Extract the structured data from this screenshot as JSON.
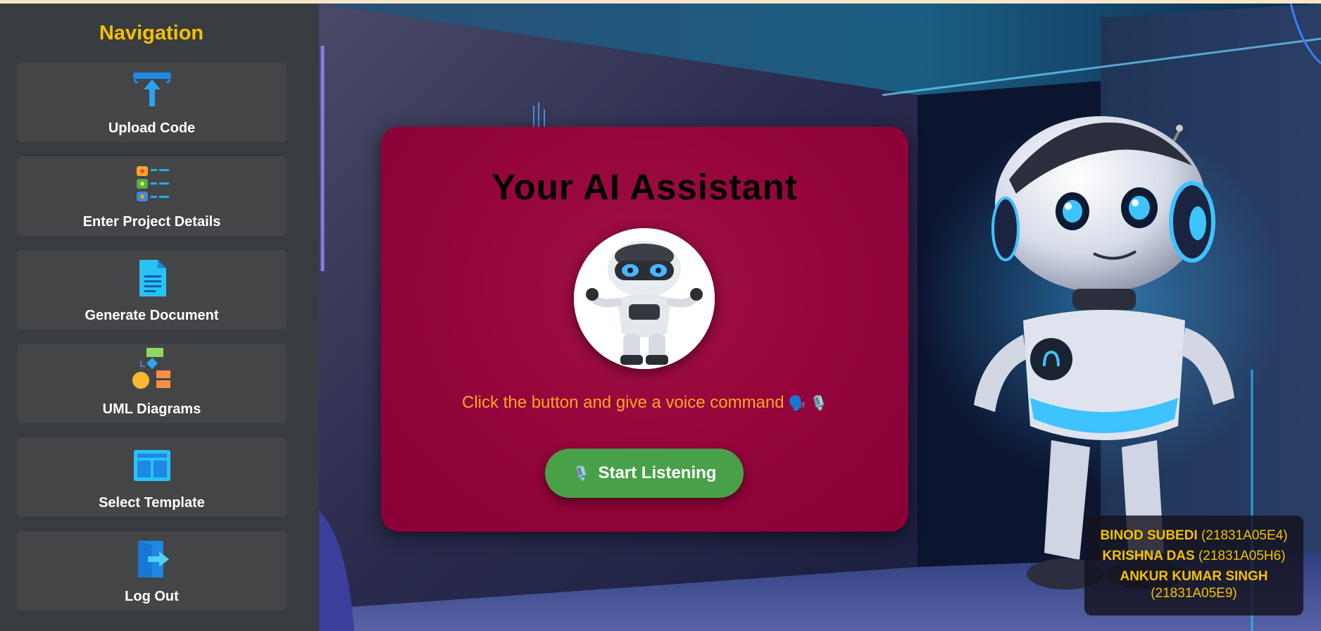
{
  "nav": {
    "title": "Navigation",
    "items": [
      {
        "label": "Upload Code",
        "icon": "upload-icon"
      },
      {
        "label": "Enter Project Details",
        "icon": "checklist-icon"
      },
      {
        "label": "Generate Document",
        "icon": "document-icon"
      },
      {
        "label": "UML Diagrams",
        "icon": "shapes-diagram-icon"
      },
      {
        "label": "Select Template",
        "icon": "template-layout-icon"
      },
      {
        "label": "Log Out",
        "icon": "logout-icon"
      }
    ]
  },
  "assistant": {
    "title": "Your AI Assistant",
    "hint_text": "Click the button and give a voice command",
    "hint_emojis": "🗣️ 🎙️",
    "button_icon": "🎙️",
    "button_label": "Start Listening"
  },
  "credits": [
    {
      "name": "BINOD SUBEDI",
      "roll": "(21831A05E4)"
    },
    {
      "name": "KRISHNA DAS",
      "roll": "(21831A05H6)"
    },
    {
      "name": "ANKUR KUMAR SINGH",
      "roll": "(21831A05E9)"
    }
  ],
  "colors": {
    "accent": "#f5c000",
    "sidebar_bg": "#383b40",
    "nav_item_bg": "#444546",
    "card_bg": "#93053a",
    "hint_text": "#ffa51f",
    "button_bg": "#48a048"
  }
}
